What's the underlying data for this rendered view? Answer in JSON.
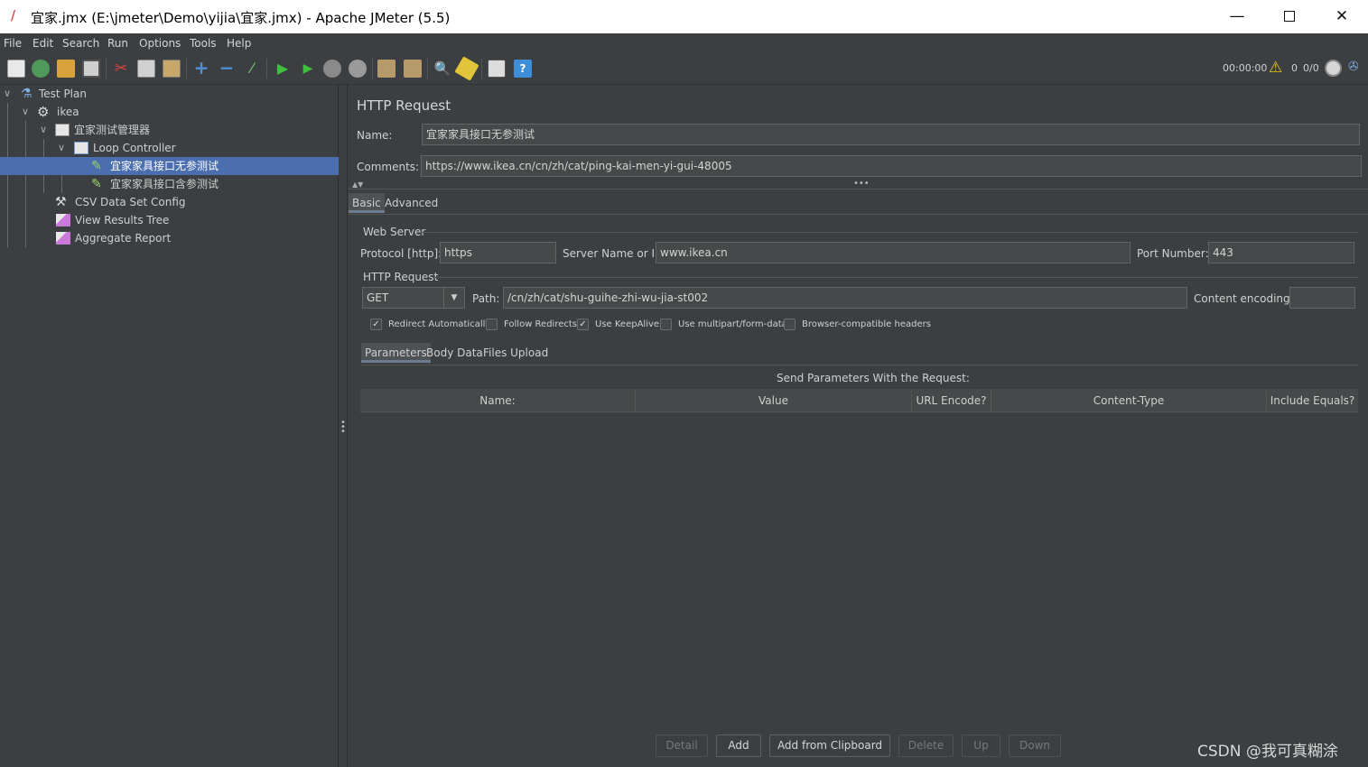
{
  "window": {
    "title": "宜家.jmx (E:\\jmeter\\Demo\\yijia\\宜家.jmx) - Apache JMeter (5.5)"
  },
  "menu": [
    "File",
    "Edit",
    "Search",
    "Run",
    "Options",
    "Tools",
    "Help"
  ],
  "toolbar": {
    "timer": "00:00:00",
    "warnings": "0",
    "threads": "0/0"
  },
  "tree": {
    "items": [
      {
        "label": "Test Plan",
        "icon": "test-plan-icon"
      },
      {
        "label": "ikea",
        "icon": "thread-group-gear-icon"
      },
      {
        "label": "宜家测试管理器",
        "icon": "controller-icon"
      },
      {
        "label": "Loop Controller",
        "icon": "loop-controller-icon"
      },
      {
        "label": "宜家家具接口无参测试",
        "icon": "http-sampler-pen-icon",
        "selected": true
      },
      {
        "label": "宜家家具接口含参测试",
        "icon": "http-sampler-pen-icon"
      },
      {
        "label": "CSV Data Set Config",
        "icon": "config-tools-icon"
      },
      {
        "label": "View Results Tree",
        "icon": "listener-graph-icon"
      },
      {
        "label": "Aggregate Report",
        "icon": "listener-graph-icon"
      }
    ]
  },
  "panel": {
    "heading": "HTTP Request",
    "name_label": "Name:",
    "name_value": "宜家家具接口无参测试",
    "comments_label": "Comments:",
    "comments_value": "https://www.ikea.cn/cn/zh/cat/ping-kai-men-yi-gui-48005",
    "tabs": [
      "Basic",
      "Advanced"
    ],
    "web_server": {
      "title": "Web Server",
      "protocol_label": "Protocol [http]:",
      "protocol_value": "https",
      "server_label": "Server Name or IP:",
      "server_value": "www.ikea.cn",
      "port_label": "Port Number:",
      "port_value": "443"
    },
    "http_request": {
      "title": "HTTP Request",
      "method": "GET",
      "path_label": "Path:",
      "path_value": "/cn/zh/cat/shu-guihe-zhi-wu-jia-st002",
      "encoding_label": "Content encoding:",
      "encoding_value": ""
    },
    "options": [
      {
        "label": "Redirect Automatically",
        "checked": true
      },
      {
        "label": "Follow Redirects",
        "checked": false
      },
      {
        "label": "Use KeepAlive",
        "checked": true
      },
      {
        "label": "Use multipart/form-data",
        "checked": false
      },
      {
        "label": "Browser-compatible headers",
        "checked": false
      }
    ],
    "subtabs": [
      "Parameters",
      "Body Data",
      "Files Upload"
    ],
    "params_caption": "Send Parameters With the Request:",
    "columns": [
      "Name:",
      "Value",
      "URL Encode?",
      "Content-Type",
      "Include Equals?"
    ],
    "buttons": [
      "Detail",
      "Add",
      "Add from Clipboard",
      "Delete",
      "Up",
      "Down"
    ]
  },
  "watermark": "CSDN @我可真糊涂"
}
